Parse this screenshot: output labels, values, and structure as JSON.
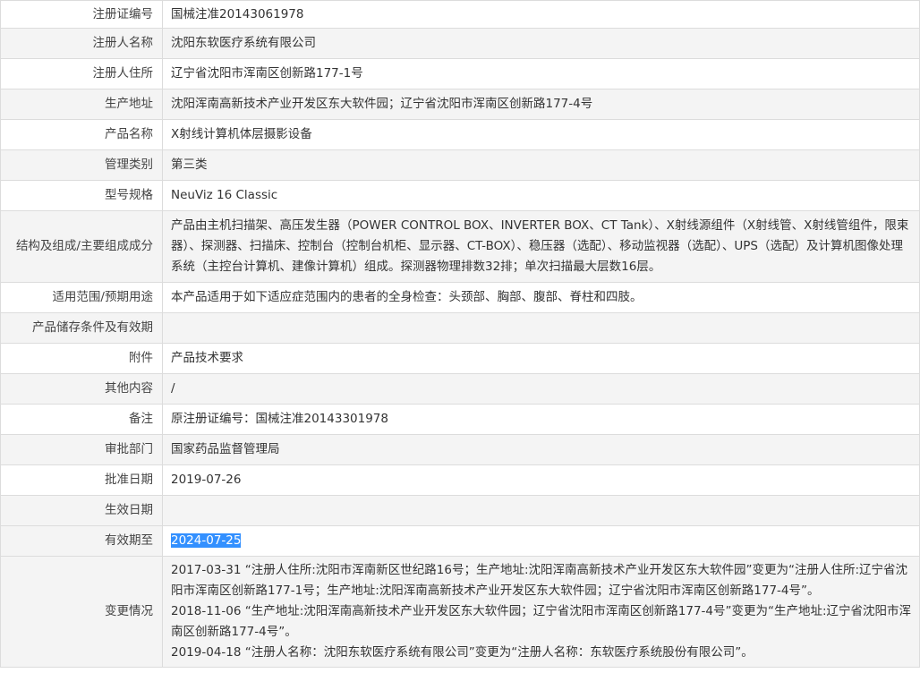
{
  "rows": [
    {
      "label": "注册证编号",
      "value": "国械注准20143061978"
    },
    {
      "label": "注册人名称",
      "value": "沈阳东软医疗系统有限公司"
    },
    {
      "label": "注册人住所",
      "value": "辽宁省沈阳市浑南区创新路177-1号"
    },
    {
      "label": "生产地址",
      "value": "沈阳浑南高新技术产业开发区东大软件园；辽宁省沈阳市浑南区创新路177-4号"
    },
    {
      "label": "产品名称",
      "value": "X射线计算机体层摄影设备"
    },
    {
      "label": "管理类别",
      "value": "第三类"
    },
    {
      "label": "型号规格",
      "value": "NeuViz 16 Classic"
    },
    {
      "label": "结构及组成/主要组成成分",
      "value": "产品由主机扫描架、高压发生器（POWER CONTROL BOX、INVERTER BOX、CT Tank）、X射线源组件（X射线管、X射线管组件，限束器）、探测器、扫描床、控制台（控制台机柜、显示器、CT-BOX）、稳压器（选配）、移动监视器（选配）、UPS（选配）及计算机图像处理系统（主控台计算机、建像计算机）组成。探测器物理排数32排；单次扫描最大层数16层。"
    },
    {
      "label": "适用范围/预期用途",
      "value": "本产品适用于如下适应症范围内的患者的全身检查：头颈部、胸部、腹部、脊柱和四肢。"
    },
    {
      "label": "产品储存条件及有效期",
      "value": ""
    },
    {
      "label": "附件",
      "value": "产品技术要求"
    },
    {
      "label": "其他内容",
      "value": "/"
    },
    {
      "label": "备注",
      "value": "原注册证编号：国械注准20143301978"
    },
    {
      "label": "审批部门",
      "value": "国家药品监督管理局"
    },
    {
      "label": "批准日期",
      "value": "2019-07-26"
    },
    {
      "label": "生效日期",
      "value": ""
    },
    {
      "label": "有效期至",
      "value": "2024-07-25"
    },
    {
      "label": "变更情况",
      "lines": [
        "2017-03-31 “注册人住所:沈阳市浑南新区世纪路16号；生产地址:沈阳浑南高新技术产业开发区东大软件园”变更为“注册人住所:辽宁省沈阳市浑南区创新路177-1号；生产地址:沈阳浑南高新技术产业开发区东大软件园；辽宁省沈阳市浑南区创新路177-4号”。",
        "2018-11-06 “生产地址:沈阳浑南高新技术产业开发区东大软件园；辽宁省沈阳市浑南区创新路177-4号”变更为“生产地址:辽宁省沈阳市浑南区创新路177-4号”。",
        "2019-04-18 “注册人名称：沈阳东软医疗系统有限公司”变更为“注册人名称：东软医疗系统股份有限公司”。"
      ]
    }
  ]
}
